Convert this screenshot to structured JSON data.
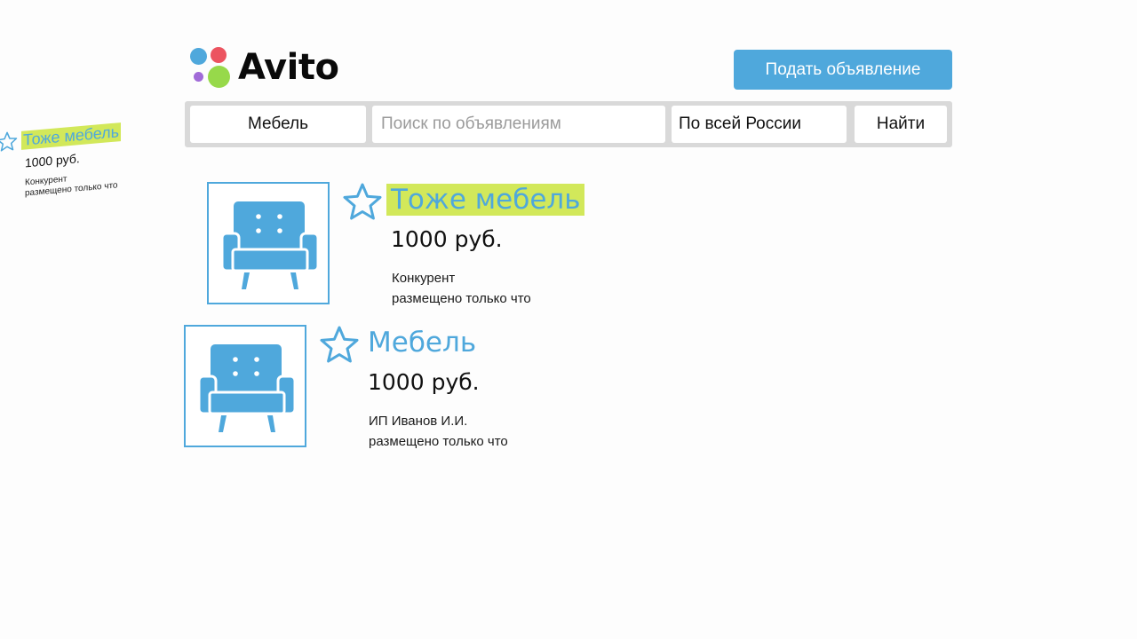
{
  "brand": {
    "name": "Avito",
    "dot_colors": [
      "#4fa8dc",
      "#ec5460",
      "#a16bd8",
      "#97d94a"
    ]
  },
  "header": {
    "post_button_label": "Подать объявление",
    "accent_color": "#4fa8dc"
  },
  "search": {
    "category": "Мебель",
    "query_value": "",
    "query_placeholder": "Поиск по объявлениям",
    "region": "По всей России",
    "submit_label": "Найти"
  },
  "listings": [
    {
      "title": "Тоже мебель",
      "title_highlighted": true,
      "price": "1000 руб.",
      "seller": "Конкурент",
      "posted": "размещено только что",
      "image_icon": "armchair-icon",
      "favorite_icon": "star-outline-icon"
    },
    {
      "title": "Мебель",
      "title_highlighted": false,
      "price": "1000 руб.",
      "seller": "ИП Иванов И.И.",
      "posted": "размещено только что",
      "image_icon": "armchair-icon",
      "favorite_icon": "star-outline-icon"
    }
  ],
  "ghost_card": {
    "title": "Тоже мебель",
    "price": "1000 руб.",
    "seller": "Конкурент",
    "posted": "размещено только что"
  },
  "highlight_color": "#d2e85a"
}
